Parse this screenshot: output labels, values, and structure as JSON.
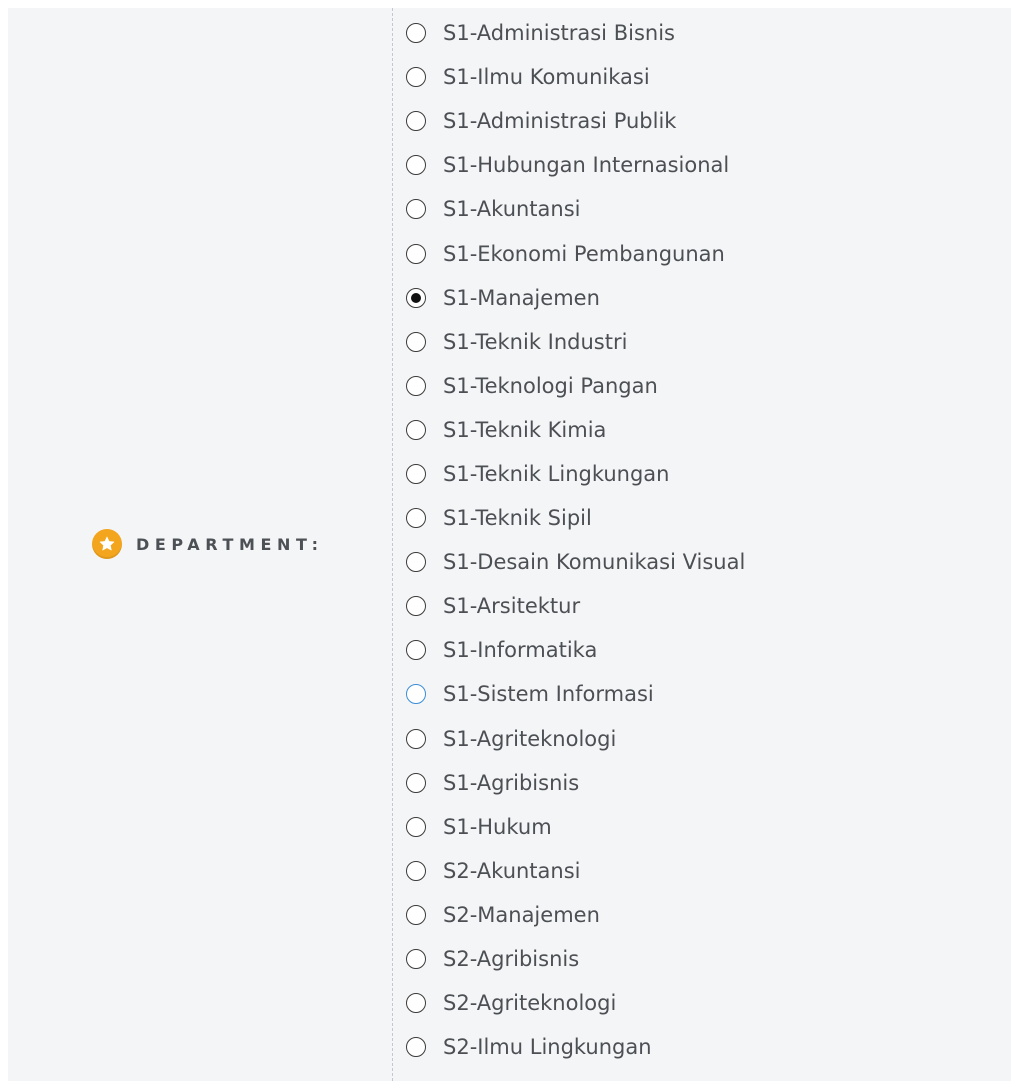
{
  "field": {
    "label": "DEPARTMENT:",
    "icon": "star-icon",
    "icon_color": "#f3a51d"
  },
  "options": [
    {
      "label": "S1-Administrasi Bisnis",
      "checked": false
    },
    {
      "label": "S1-Ilmu Komunikasi",
      "checked": false
    },
    {
      "label": "S1-Administrasi Publik",
      "checked": false
    },
    {
      "label": "S1-Hubungan Internasional",
      "checked": false
    },
    {
      "label": "S1-Akuntansi",
      "checked": false
    },
    {
      "label": "S1-Ekonomi Pembangunan",
      "checked": false
    },
    {
      "label": "S1-Manajemen",
      "checked": true
    },
    {
      "label": "S1-Teknik Industri",
      "checked": false
    },
    {
      "label": "S1-Teknologi Pangan",
      "checked": false
    },
    {
      "label": "S1-Teknik Kimia",
      "checked": false
    },
    {
      "label": "S1-Teknik Lingkungan",
      "checked": false
    },
    {
      "label": "S1-Teknik Sipil",
      "checked": false
    },
    {
      "label": "S1-Desain Komunikasi Visual",
      "checked": false
    },
    {
      "label": "S1-Arsitektur",
      "checked": false
    },
    {
      "label": "S1-Informatika",
      "checked": false
    },
    {
      "label": "S1-Sistem Informasi",
      "checked": false,
      "hover": true
    },
    {
      "label": "S1-Agriteknologi",
      "checked": false
    },
    {
      "label": "S1-Agribisnis",
      "checked": false
    },
    {
      "label": "S1-Hukum",
      "checked": false
    },
    {
      "label": "S2-Akuntansi",
      "checked": false
    },
    {
      "label": "S2-Manajemen",
      "checked": false
    },
    {
      "label": "S2-Agribisnis",
      "checked": false
    },
    {
      "label": "S2-Agriteknologi",
      "checked": false
    },
    {
      "label": "S2-Ilmu Lingkungan",
      "checked": false
    }
  ]
}
